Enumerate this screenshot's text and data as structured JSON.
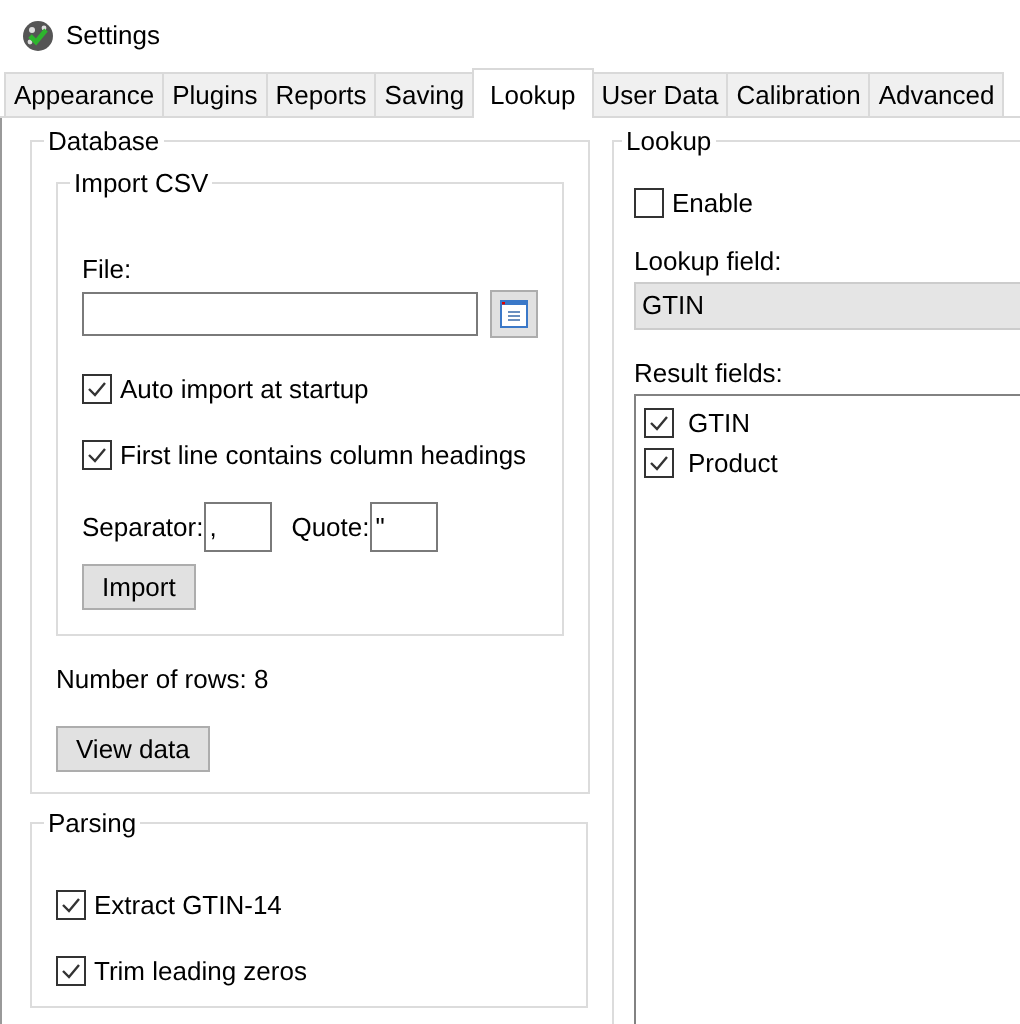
{
  "window": {
    "title": "Settings"
  },
  "tabs": [
    {
      "label": "Appearance",
      "selected": false
    },
    {
      "label": "Plugins",
      "selected": false
    },
    {
      "label": "Reports",
      "selected": false
    },
    {
      "label": "Saving",
      "selected": false
    },
    {
      "label": "Lookup",
      "selected": true
    },
    {
      "label": "User Data",
      "selected": false
    },
    {
      "label": "Calibration",
      "selected": false
    },
    {
      "label": "Advanced",
      "selected": false
    }
  ],
  "database": {
    "title": "Database",
    "import_csv": {
      "title": "Import CSV",
      "file_label": "File:",
      "options": [
        {
          "label": "Auto import at startup",
          "checked": true
        },
        {
          "label": "First line contains column headings",
          "checked": true
        }
      ],
      "separator_label": "Separator:",
      "separator_value": ",",
      "quote_label": "Quote:",
      "quote_value": "\"",
      "import_button": "Import"
    },
    "row_count": "Number of rows: 8",
    "view_button": "View data"
  },
  "parsing": {
    "title": "Parsing",
    "options": [
      {
        "label": "Extract GTIN-14",
        "checked": true
      },
      {
        "label": "Trim leading zeros",
        "checked": true
      }
    ]
  },
  "lookup": {
    "title": "Lookup",
    "enable": {
      "label": "Enable",
      "checked": false
    },
    "lookup_field_label": "Lookup field:",
    "lookup_field_value": "GTIN",
    "result_fields_label": "Result fields:",
    "result_fields": [
      {
        "label": "GTIN",
        "checked": true
      },
      {
        "label": "Product",
        "checked": true
      }
    ]
  }
}
